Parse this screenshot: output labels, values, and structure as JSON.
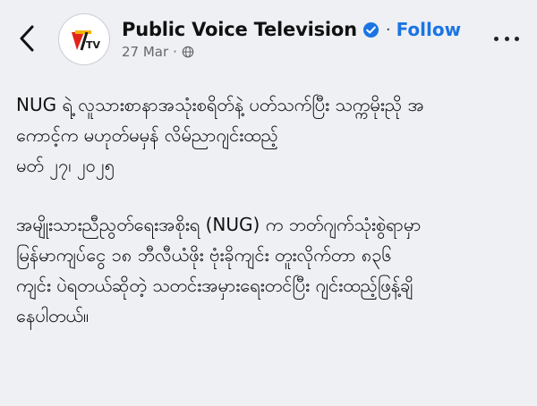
{
  "header": {
    "page_name": "Public Voice Television",
    "follow_label": "Follow",
    "timestamp": "27 Mar",
    "privacy_icon": "globe-icon",
    "verified_icon": "verified-badge-icon",
    "avatar_logo_text": "TV",
    "back_icon": "chevron-left-icon",
    "more_icon": "more-horizontal-icon",
    "accent_color": "#1b74e4"
  },
  "post": {
    "headline": "NUG ရဲ့ လူသားစာနာအသုံးစရိတ်နဲ့ ပတ်သက်ပြီး သက္ကမိုးညို အ\nကောင့်က မဟုတ်မမှန် လိမ်ညာဂျင်းထည့်",
    "date_line": "မတ် ၂၇၊ ၂၀၂၅",
    "paragraph": "အမျိုးသားညီညွတ်ရေးအစိုးရ (NUG) က ဘတ်ဂျက်သုံးစွဲရာမှာ\nမြန်မာကျပ်ငွေ ၁၈ ဘီလီယံဖိုး ဗုံးခိုကျင်း တူးလိုက်တာ ၈၃၆\nကျင်း ပဲရတယ်ဆိုတဲ့ သတင်းအမှားရေးတင်ပြီး ဂျင်းထည့်ဖြန့်ချိ\nနေပါတယ်။"
  }
}
